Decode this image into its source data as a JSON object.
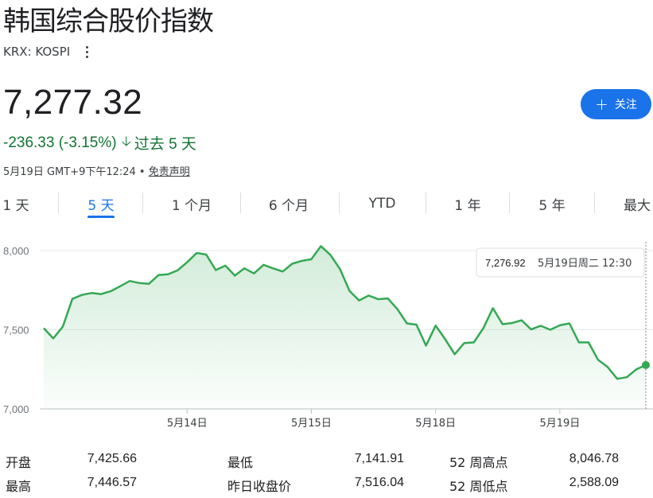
{
  "title": "韩国综合股价指数",
  "ticker": "KRX: KOSPI",
  "price": "7,277.32",
  "change": "-236.33 (-3.15%)",
  "change_period": "过去 5 天",
  "timestamp": "5月19日 GMT+9下午12:24 •",
  "disclaimer": "免责声明",
  "follow_label": "关注",
  "colors": {
    "accent": "#1a73e8",
    "positive_down": "#137333",
    "line": "#34a853"
  },
  "tabs": [
    {
      "label": "1 天"
    },
    {
      "label": "5 天",
      "active": true
    },
    {
      "label": "1 个月"
    },
    {
      "label": "6 个月"
    },
    {
      "label": "YTD"
    },
    {
      "label": "1 年"
    },
    {
      "label": "5 年"
    },
    {
      "label": "最大"
    }
  ],
  "tooltip": {
    "value": "7,276.92",
    "time": "5月19日周二 12:30"
  },
  "chart_data": {
    "type": "line",
    "ylim": [
      7000,
      8000
    ],
    "y_ticks": [
      "8,000",
      "7,500",
      "7,000"
    ],
    "y_tick_values": [
      8000,
      7500,
      7000
    ],
    "x_tick_labels": [
      "5月14日",
      "5月15日",
      "5月18日",
      "5月19日"
    ],
    "x_tick_indices": [
      15,
      28,
      41,
      54
    ],
    "series": [
      {
        "values": [
          7510,
          7445,
          7520,
          7695,
          7720,
          7732,
          7725,
          7743,
          7775,
          7808,
          7795,
          7790,
          7845,
          7850,
          7875,
          7926,
          7985,
          7975,
          7877,
          7905,
          7842,
          7888,
          7856,
          7910,
          7888,
          7868,
          7917,
          7935,
          7945,
          8028,
          7972,
          7883,
          7745,
          7685,
          7716,
          7693,
          7698,
          7630,
          7540,
          7532,
          7400,
          7526,
          7440,
          7345,
          7416,
          7420,
          7510,
          7636,
          7535,
          7542,
          7560,
          7502,
          7525,
          7500,
          7528,
          7540,
          7420,
          7420,
          7310,
          7265,
          7190,
          7200,
          7250,
          7277
        ]
      }
    ]
  },
  "stats": [
    {
      "label": "开盘",
      "value": "7,425.66"
    },
    {
      "label": "最高",
      "value": "7,446.57"
    },
    {
      "label": "最低",
      "value": "7,141.91"
    },
    {
      "label": "昨日收盘价",
      "value": "7,516.04"
    },
    {
      "label": "52 周高点",
      "value": "8,046.78"
    },
    {
      "label": "52 周低点",
      "value": "2,588.09"
    }
  ]
}
